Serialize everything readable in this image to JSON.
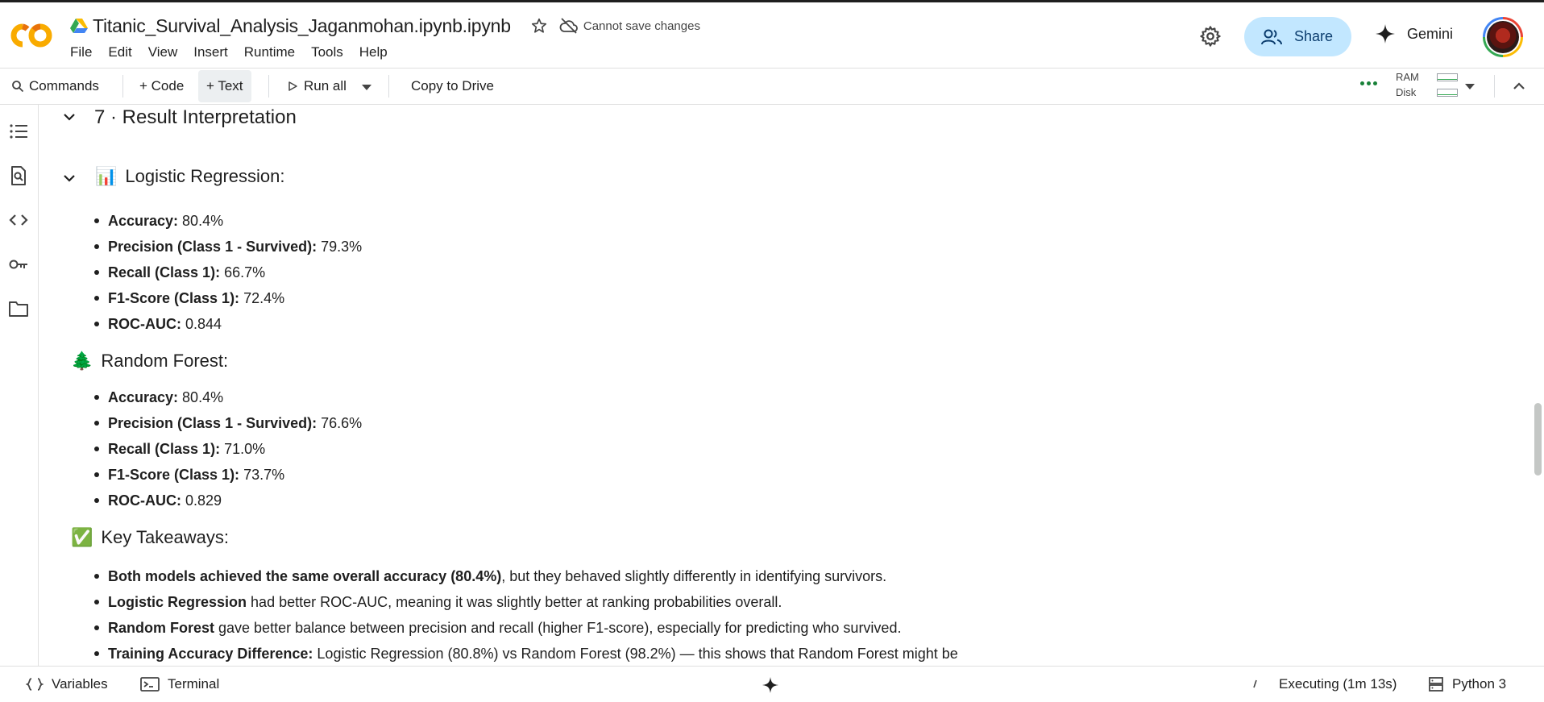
{
  "app": {
    "title": "Titanic_Survival_Analysis_Jaganmohan.ipynb.ipynb",
    "save_status": "Cannot save changes",
    "menu": [
      "File",
      "Edit",
      "View",
      "Insert",
      "Runtime",
      "Tools",
      "Help"
    ],
    "share_label": "Share",
    "gemini_label": "Gemini"
  },
  "toolbar": {
    "commands": "Commands",
    "code": "+ Code",
    "text": "+ Text",
    "run_all": "Run all",
    "copy_to_drive": "Copy to Drive",
    "ram_label": "RAM",
    "disk_label": "Disk"
  },
  "rail": {
    "icons": [
      "table-of-contents-icon",
      "find-icon",
      "code-snippets-icon",
      "secrets-key-icon",
      "files-folder-icon"
    ]
  },
  "notebook": {
    "section_heading": "7 · Result Interpretation",
    "logistic": {
      "emoji": "📊",
      "heading": "Logistic Regression:",
      "items": [
        {
          "label": "Accuracy:",
          "value": " 80.4%"
        },
        {
          "label": "Precision (Class 1 - Survived):",
          "value": " 79.3%"
        },
        {
          "label": "Recall (Class 1):",
          "value": " 66.7%"
        },
        {
          "label": "F1-Score (Class 1):",
          "value": " 72.4%"
        },
        {
          "label": "ROC-AUC:",
          "value": " 0.844"
        }
      ]
    },
    "forest": {
      "emoji": "🌲",
      "heading": "Random Forest:",
      "items": [
        {
          "label": "Accuracy:",
          "value": " 80.4%"
        },
        {
          "label": "Precision (Class 1 - Survived):",
          "value": " 76.6%"
        },
        {
          "label": "Recall (Class 1):",
          "value": " 71.0%"
        },
        {
          "label": "F1-Score (Class 1):",
          "value": " 73.7%"
        },
        {
          "label": "ROC-AUC:",
          "value": " 0.829"
        }
      ]
    },
    "takeaways": {
      "emoji": "✅",
      "heading": "Key Takeaways:",
      "items": [
        {
          "label": "Both models achieved the same overall accuracy (80.4%)",
          "value": ", but they behaved slightly differently in identifying survivors."
        },
        {
          "label": "Logistic Regression",
          "value": " had better ROC-AUC, meaning it was slightly better at ranking probabilities overall."
        },
        {
          "label": "Random Forest",
          "value": " gave better balance between precision and recall (higher F1-score), especially for predicting who survived."
        },
        {
          "label": "Training Accuracy Difference:",
          "value": " Logistic Regression (80.8%) vs Random Forest (98.2%) — this shows that Random Forest might be"
        }
      ]
    }
  },
  "statusbar": {
    "variables": "Variables",
    "terminal": "Terminal",
    "executing": "Executing (1m 13s)",
    "runtime": "Python 3"
  },
  "colors": {
    "share_bg": "#c2e7ff",
    "logo_orange": "#f9ab00",
    "resource_green": "#188038"
  }
}
